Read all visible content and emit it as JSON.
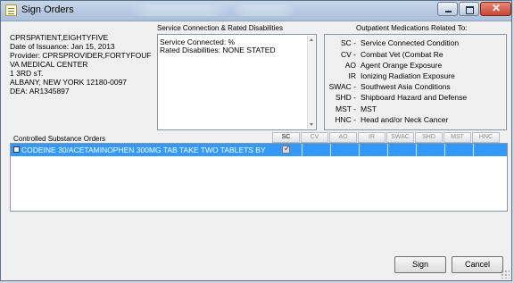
{
  "window": {
    "title": "Sign Orders"
  },
  "patient": {
    "lines": [
      "CPRSPATIENT,EIGHTYFIVE",
      "Date of Issuance: Jan 15, 2013",
      "Provider: CPRSPROVIDER,FORTYFOUF",
      "VA MEDICAL CENTER",
      "1 3RD sT.",
      "ALBANY, NEW YORK  12180-0097",
      "DEA: AR1345897"
    ]
  },
  "service": {
    "label": "Service Connection & Rated Disabilities",
    "lines": [
      "Service Connected: %",
      "Rated Disabilities: NONE STATED"
    ]
  },
  "outpatient": {
    "label": "Outpatient Medications Related To:",
    "items": [
      {
        "code": "SC -",
        "description": "Service Connected Condition"
      },
      {
        "code": "CV -",
        "description": "Combat Vet (Combat Re"
      },
      {
        "code": "AO",
        "description": "Agent Orange Exposure"
      },
      {
        "code": "IR",
        "description": "Ionizing Radiation Exposure"
      },
      {
        "code": "SWAC -",
        "description": "Southwest Asia Conditions"
      },
      {
        "code": "SHD -",
        "description": "Shipboard Hazard and Defense"
      },
      {
        "code": "MST -",
        "description": "MST"
      },
      {
        "code": "HNC -",
        "description": "Head and/or Neck Cancer"
      }
    ]
  },
  "orders": {
    "label": "Controlled Substance Orders",
    "columns": [
      "SC",
      "CV",
      "AO",
      "IR",
      "SWAC",
      "SHD",
      "MST",
      "HNC"
    ],
    "rows": [
      {
        "text": "CODEINE 30/ACETAMINOPHEN 300MG TAB  TAKE TWO TABLETS BY"
      }
    ]
  },
  "buttons": {
    "sign": "Sign",
    "cancel": "Cancel"
  }
}
